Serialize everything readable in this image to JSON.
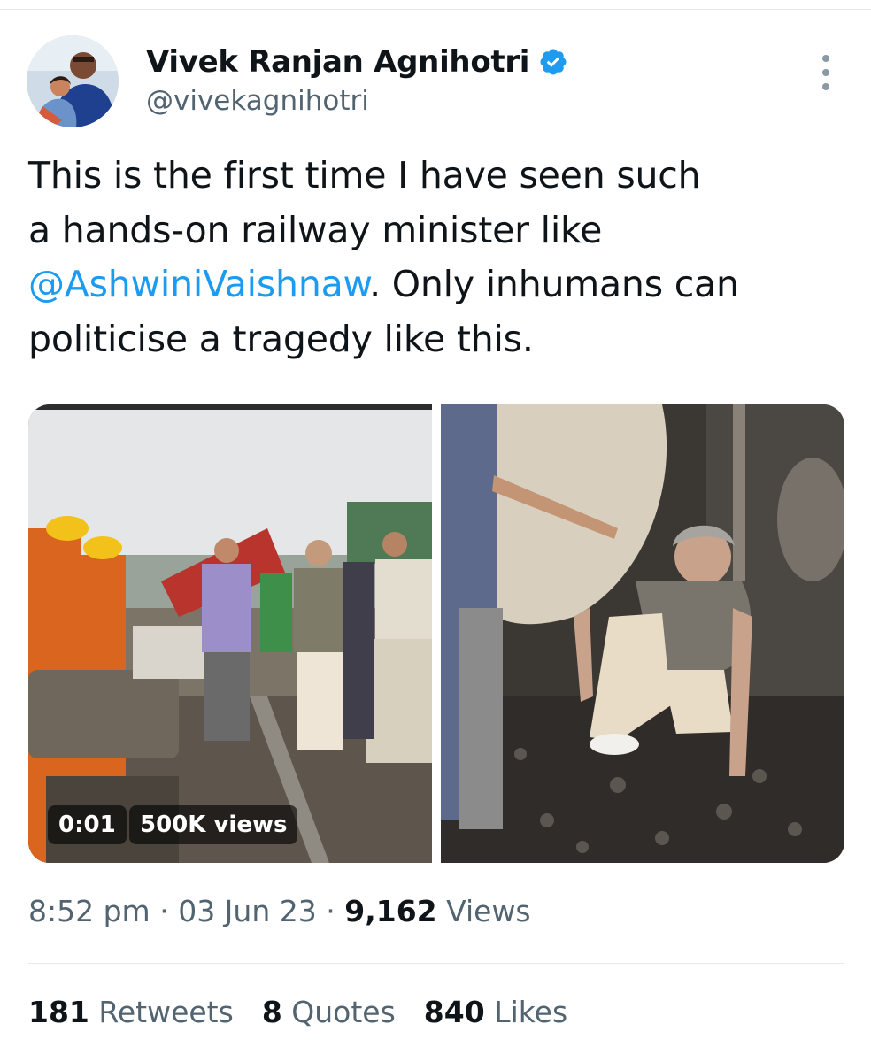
{
  "author": {
    "display_name": "Vivek Ranjan Agnihotri",
    "handle": "@vivekagnihotri",
    "verified": true,
    "avatar_icon": "profile-photo"
  },
  "tweet": {
    "text_lines": [
      "This is the first time I have seen such",
      "a hands-on railway minister like"
    ],
    "mention": "@AshwiniVaishnaw",
    "line3_rest": ". Only inhumans can",
    "line4": "politicise a tragedy like this."
  },
  "media": {
    "video_duration": "0:01",
    "video_views": "500K views"
  },
  "meta": {
    "time": "8:52 pm",
    "date": "03 Jun 23",
    "separator": "·",
    "views_count": "9,162",
    "views_label": "Views"
  },
  "stats": {
    "retweets_count": "181",
    "retweets_label": "Retweets",
    "quotes_count": "8",
    "quotes_label": "Quotes",
    "likes_count": "840",
    "likes_label": "Likes"
  },
  "colors": {
    "link": "#1d9bf0",
    "verified_badge": "#1d9bf0",
    "secondary_text": "#536471",
    "primary_text": "#0f1419"
  }
}
